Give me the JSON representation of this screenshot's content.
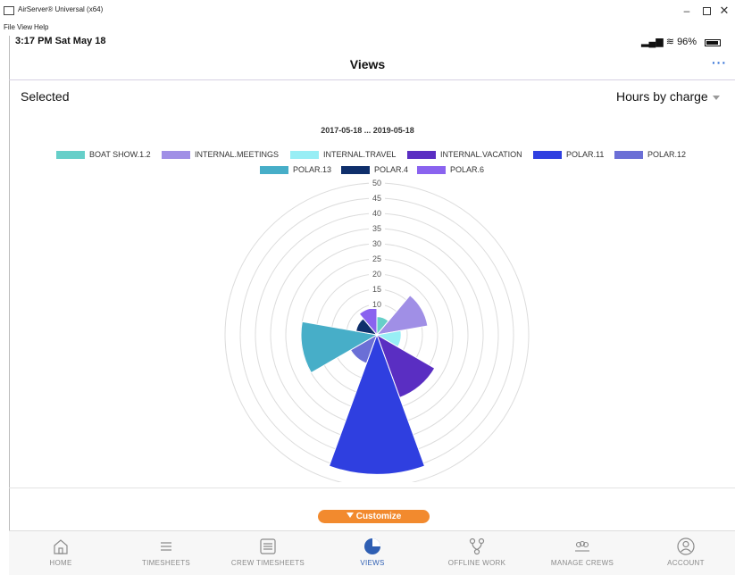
{
  "window": {
    "title": "AirServer® Universal (x64)",
    "minimize_glyph": "–",
    "close_glyph": "✕"
  },
  "menu": {
    "items": [
      "File",
      "View",
      "Help"
    ]
  },
  "status_bar": {
    "time_date": "3:17 PM  Sat May 18",
    "battery": "96%"
  },
  "nav": {
    "title": "Views",
    "more": "···"
  },
  "filter": {
    "selected_label": "Selected",
    "dropdown_value": "Hours by charge"
  },
  "date_range": "2017-05-18 ... 2019-05-18",
  "colors": {
    "accent": "#f28a2e",
    "active_tab": "#2f5fb3",
    "series": [
      "#66cfc9",
      "#a08fe6",
      "#98eef5",
      "#5a2ec2",
      "#2f3fe0",
      "#6b6fd6",
      "#47aec8",
      "#0f2f6b",
      "#8a63ef"
    ]
  },
  "chart_data": {
    "type": "polar-area",
    "title": "",
    "rlim": [
      0,
      50
    ],
    "ticks": [
      "10",
      "15",
      "20",
      "25",
      "30",
      "35",
      "40",
      "45",
      "50"
    ],
    "tick_values": [
      10,
      15,
      20,
      25,
      30,
      35,
      40,
      45,
      50
    ],
    "series": [
      {
        "name": "BOAT SHOW.1.2",
        "value": 6
      },
      {
        "name": "INTERNAL.MEETINGS",
        "value": 17
      },
      {
        "name": "INTERNAL.TRAVEL",
        "value": 8
      },
      {
        "name": "INTERNAL.VACATION",
        "value": 22
      },
      {
        "name": "POLAR.11",
        "value": 46
      },
      {
        "name": "POLAR.12",
        "value": 10
      },
      {
        "name": "POLAR.13",
        "value": 25
      },
      {
        "name": "POLAR.4",
        "value": 7
      },
      {
        "name": "POLAR.6",
        "value": 9
      }
    ],
    "legend_position": "top",
    "grid": true
  },
  "customize_label": "Customize",
  "tabs": [
    {
      "label": "HOME",
      "icon": "home-icon"
    },
    {
      "label": "TIMESHEETS",
      "icon": "list-icon"
    },
    {
      "label": "CREW TIMESHEETS",
      "icon": "crew-timesheets-icon"
    },
    {
      "label": "VIEWS",
      "icon": "pie-chart-icon"
    },
    {
      "label": "OFFLINE WORK",
      "icon": "network-icon"
    },
    {
      "label": "MANAGE CREWS",
      "icon": "people-icon"
    },
    {
      "label": "ACCOUNT",
      "icon": "user-icon"
    }
  ]
}
